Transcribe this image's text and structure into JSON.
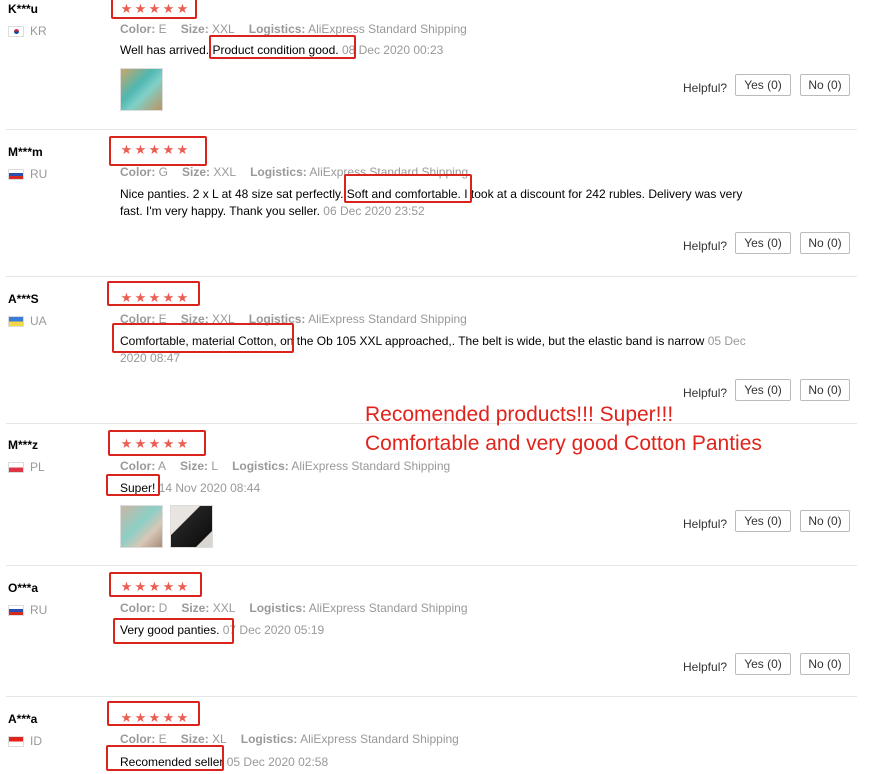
{
  "labels": {
    "color": "Color:",
    "size": "Size:",
    "logistics": "Logistics:",
    "helpful": "Helpful?",
    "yes": "Yes (0)",
    "no": "No (0)"
  },
  "star_glyph": "★",
  "reviews": [
    {
      "user": "K***u",
      "country": "KR",
      "color": "E",
      "size": "XXL",
      "logistics": "AliExpress Standard Shipping",
      "text_before": "Well has arrived.",
      "text_hl": "Product condition good.",
      "text_after": "",
      "date": "08 Dec 2020 00:23",
      "rating": 5
    },
    {
      "user": "M***m",
      "country": "RU",
      "color": "G",
      "size": "XXL",
      "logistics": "AliExpress Standard Shipping",
      "text_before": "Nice panties. 2 x L at 48 size sat perfectly.",
      "text_hl": "Soft and comfortable.",
      "text_after": "I took at a discount for 242 rubles. Delivery was very",
      "text_line2": "fast. I'm very happy. Thank you seller.",
      "date": "06 Dec 2020 23:52",
      "rating": 5
    },
    {
      "user": "A***S",
      "country": "UA",
      "color": "E",
      "size": "XXL",
      "logistics": "AliExpress Standard Shipping",
      "text_before": "",
      "text_hl": "Comfortable, material Cotton,",
      "text_after": "on the Ob 105 XXL approached,. The belt is wide, but the elastic band is narrow",
      "date": "05 Dec",
      "date_line2": "2020 08:47",
      "rating": 5
    },
    {
      "user": "M***z",
      "country": "PL",
      "color": "A",
      "size": "L",
      "logistics": "AliExpress Standard Shipping",
      "text_before": "",
      "text_hl": "Super!",
      "text_after": "",
      "date": "14 Nov 2020 08:44",
      "rating": 5
    },
    {
      "user": "O***a",
      "country": "RU",
      "color": "D",
      "size": "XXL",
      "logistics": "AliExpress Standard Shipping",
      "text_before": "",
      "text_hl": "Very good panties.",
      "text_after": "",
      "date": "07 Dec 2020 05:19",
      "rating": 5
    },
    {
      "user": "A***a",
      "country": "ID",
      "color": "E",
      "size": "XL",
      "logistics": "AliExpress Standard Shipping",
      "text_before": "",
      "text_hl": "Recomended seller",
      "text_after": "",
      "date": "05 Dec 2020 02:58",
      "rating": 5
    }
  ],
  "overlay": {
    "line1": "Recomended products!!! Super!!!",
    "line2": "Comfortable and very good Cotton Panties"
  },
  "colors": {
    "star": "#ea5d52",
    "highlight": "#d9231c",
    "overlay": "#e0231b"
  }
}
